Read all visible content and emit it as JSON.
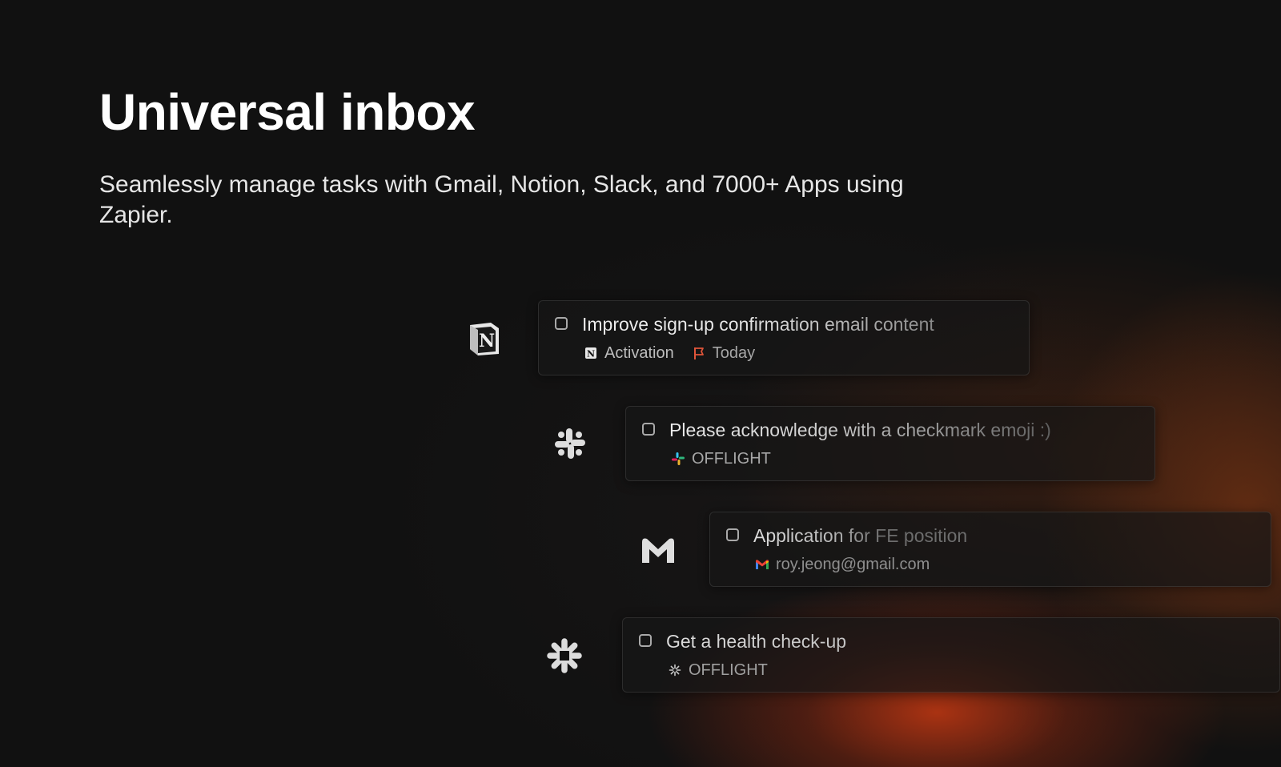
{
  "hero": {
    "title": "Universal inbox",
    "subtitle": "Seamlessly manage tasks with Gmail, Notion, Slack, and 7000+ Apps using Zapier."
  },
  "tasks": [
    {
      "app": "notion-icon",
      "title": "Improve sign-up confirmation email content",
      "tag_icon": "notion-icon",
      "tag": "Activation",
      "due_icon": "flag-icon",
      "due": "Today"
    },
    {
      "app": "slack-icon",
      "title": "Please acknowledge with a checkmark emoji :)",
      "tag_icon": "slack-icon",
      "tag": "OFFLIGHT"
    },
    {
      "app": "gmail-icon",
      "title": "Application for FE position",
      "tag_icon": "gmail-icon",
      "tag": "roy.jeong@gmail.com"
    },
    {
      "app": "zapier-icon",
      "title": "Get a health check-up",
      "tag_icon": "zapier-icon",
      "tag": "OFFLIGHT"
    }
  ],
  "colors": {
    "background": "#111111",
    "accent_glow": "#c43812",
    "flag": "#e0553a",
    "slack_green": "#2eb67d",
    "slack_blue": "#36c5f0",
    "slack_red": "#e01e5a",
    "slack_yellow": "#ecb22e",
    "gmail_red": "#ea4335"
  }
}
